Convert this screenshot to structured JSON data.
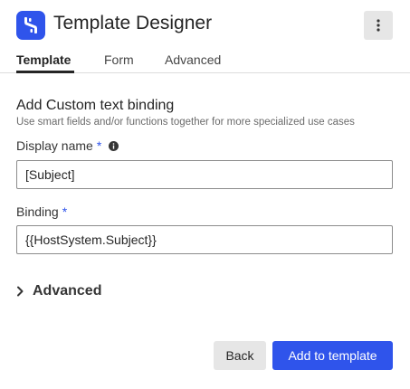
{
  "header": {
    "title": "Template Designer",
    "logo_icon": "brand-logo-icon",
    "menu_icon": "more-vertical-icon",
    "brand_color": "#2f54eb"
  },
  "tabs": [
    {
      "label": "Template",
      "active": true
    },
    {
      "label": "Form",
      "active": false
    },
    {
      "label": "Advanced",
      "active": false
    }
  ],
  "section": {
    "title": "Add Custom text binding",
    "subtitle": "Use smart fields and/or functions together for more specialized use cases"
  },
  "fields": {
    "display_name": {
      "label": "Display name",
      "required_mark": "*",
      "value": "[Subject]",
      "info_icon": "info-icon"
    },
    "binding": {
      "label": "Binding",
      "required_mark": "*",
      "value": "{{HostSystem.Subject}}"
    }
  },
  "advanced": {
    "label": "Advanced",
    "icon": "chevron-right-icon"
  },
  "actions": {
    "back_label": "Back",
    "add_label": "Add to template"
  }
}
